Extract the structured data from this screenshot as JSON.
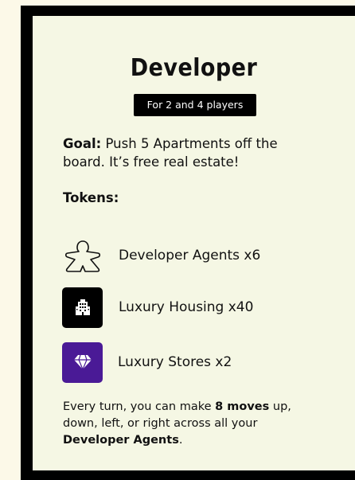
{
  "card": {
    "title": "Developer",
    "players_badge": "For 2 and 4 players",
    "goal": {
      "label": "Goal:",
      "text": " Push 5 Apartments off the board. It’s free real estate!"
    },
    "tokens_heading": "Tokens:",
    "tokens": [
      {
        "icon": "meeple-outline-icon",
        "label": "Developer Agents x6"
      },
      {
        "icon": "building-icon",
        "label": "Luxury Housing x40"
      },
      {
        "icon": "diamond-icon",
        "label": "Luxury Stores x2"
      }
    ],
    "rules": {
      "part1": "Every turn, you can make ",
      "moves": "8 moves",
      "part2": " up, down, left, or right across all your ",
      "agents": "Developer Agents",
      "part3": "."
    }
  },
  "colors": {
    "page_background": "#fcf9e8",
    "card_border": "#000000",
    "card_background": "#f5f7e4",
    "stores_icon_background": "#4a1a96",
    "housing_icon_background": "#000000"
  }
}
